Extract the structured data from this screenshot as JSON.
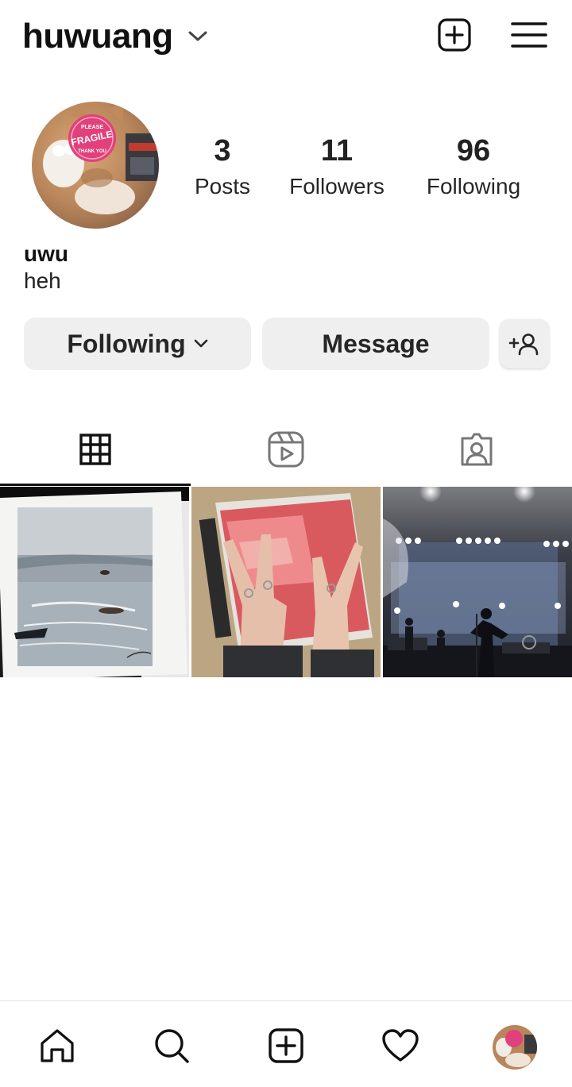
{
  "header": {
    "username": "huwuang",
    "icons": {
      "dropdown": "chevron-down-icon",
      "create": "plus-square-icon",
      "menu": "hamburger-menu-icon"
    }
  },
  "profile": {
    "avatar": "profile-photo-cat-with-fragile-sticker",
    "display_name": "uwu",
    "bio": "heh",
    "stats": {
      "posts": {
        "value": "3",
        "label": "Posts"
      },
      "followers": {
        "value": "11",
        "label": "Followers"
      },
      "following": {
        "value": "96",
        "label": "Following"
      }
    },
    "sticker_text": [
      "PLEASE",
      "FRAGILE",
      "THANK YOU"
    ]
  },
  "actions": {
    "following_label": "Following",
    "message_label": "Message",
    "suggest_icon": "add-person-icon"
  },
  "tabs": [
    {
      "id": "posts",
      "icon": "grid-icon",
      "active": true
    },
    {
      "id": "reels",
      "icon": "reels-icon",
      "active": false
    },
    {
      "id": "tagged",
      "icon": "tagged-person-icon",
      "active": false
    }
  ],
  "posts": [
    {
      "subject": "watercolor seascape painting on paper"
    },
    {
      "subject": "hands making peace signs over a pink album"
    },
    {
      "subject": "concert stage with bright lights"
    }
  ],
  "bottom_nav": [
    {
      "id": "home",
      "icon": "home-icon"
    },
    {
      "id": "search",
      "icon": "search-icon"
    },
    {
      "id": "create",
      "icon": "plus-square-icon"
    },
    {
      "id": "activity",
      "icon": "heart-icon"
    },
    {
      "id": "profile",
      "icon": "avatar"
    }
  ],
  "colors": {
    "text_primary": "#262626",
    "button_bg": "#efefef",
    "sticker_pink": "#e2407a",
    "divider": "#e6e6e6"
  }
}
